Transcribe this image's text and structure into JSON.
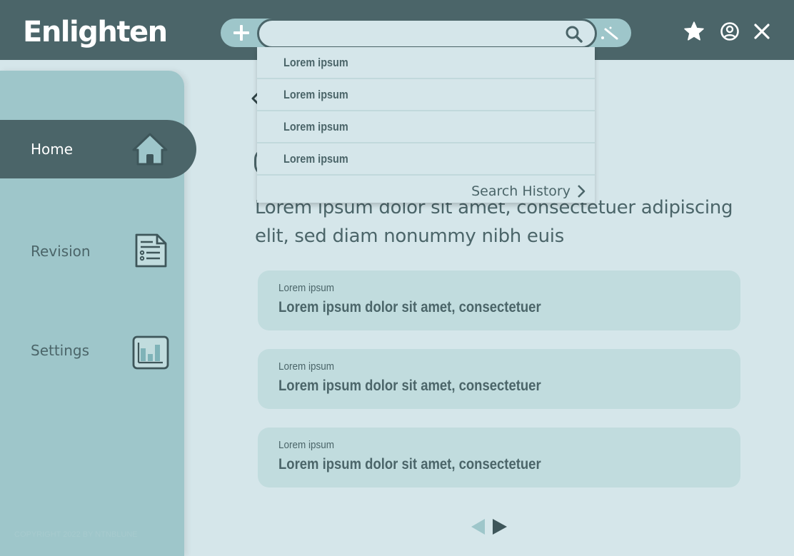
{
  "app": {
    "title": "Enlighten"
  },
  "search": {
    "value": "",
    "placeholder": ""
  },
  "dropdown": {
    "suggestions": [
      "Lorem ipsum",
      "Lorem ipsum",
      "Lorem ipsum",
      "Lorem ipsum"
    ],
    "history_label": "Search History"
  },
  "sidebar": {
    "items": [
      {
        "label": "Home",
        "icon": "home-icon",
        "active": true
      },
      {
        "label": "Revision",
        "icon": "document-list-icon",
        "active": false
      },
      {
        "label": "Settings",
        "icon": "bar-chart-icon",
        "active": false
      }
    ],
    "copyright": "COPYRIGHT 2022 BY NTNBLUNE"
  },
  "main": {
    "intro": "Lorem ipsum dolor sit amet, consectetuer adipiscing elit, sed diam nonummy nibh euis",
    "cards": [
      {
        "kicker": "Lorem ipsum",
        "title": "Lorem ipsum dolor sit amet, consectetuer"
      },
      {
        "kicker": "Lorem ipsum",
        "title": "Lorem ipsum dolor sit amet, consectetuer"
      },
      {
        "kicker": "Lorem ipsum",
        "title": "Lorem ipsum dolor sit amet, consectetuer"
      }
    ]
  },
  "colors": {
    "header": "#4b6569",
    "sidebar": "#9ec6ca",
    "background": "#d5e6ea",
    "card": "#c1dcde",
    "accent": "#4b6569"
  },
  "icons": {
    "add": "plus-icon",
    "search": "search-icon",
    "tool": "magic-wand-icon",
    "favorites": "star-icon",
    "profile": "user-circle-icon",
    "close": "close-icon",
    "back": "chevron-left-icon",
    "history": "chevron-right-icon",
    "prev": "triangle-left-icon",
    "next": "triangle-right-icon"
  }
}
